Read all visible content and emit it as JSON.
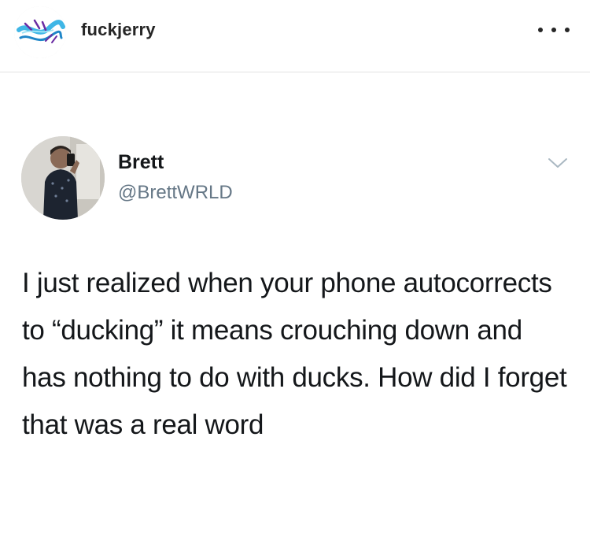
{
  "instagram_post": {
    "header": {
      "username": "fuckjerry",
      "avatar_icon": "brand-logo-icon",
      "more_icon": "more-options-icon"
    }
  },
  "tweet": {
    "author": {
      "display_name": "Brett",
      "handle": "@BrettWRLD",
      "avatar_icon": "profile-photo"
    },
    "menu_icon": "chevron-down-icon",
    "text": "I just realized when your phone autocorrects to “ducking” it means crouching down and has nothing to do with ducks. How did I forget that was a real word"
  },
  "colors": {
    "handle": "#657786",
    "text": "#14171a",
    "divider": "#e3e3e3"
  }
}
